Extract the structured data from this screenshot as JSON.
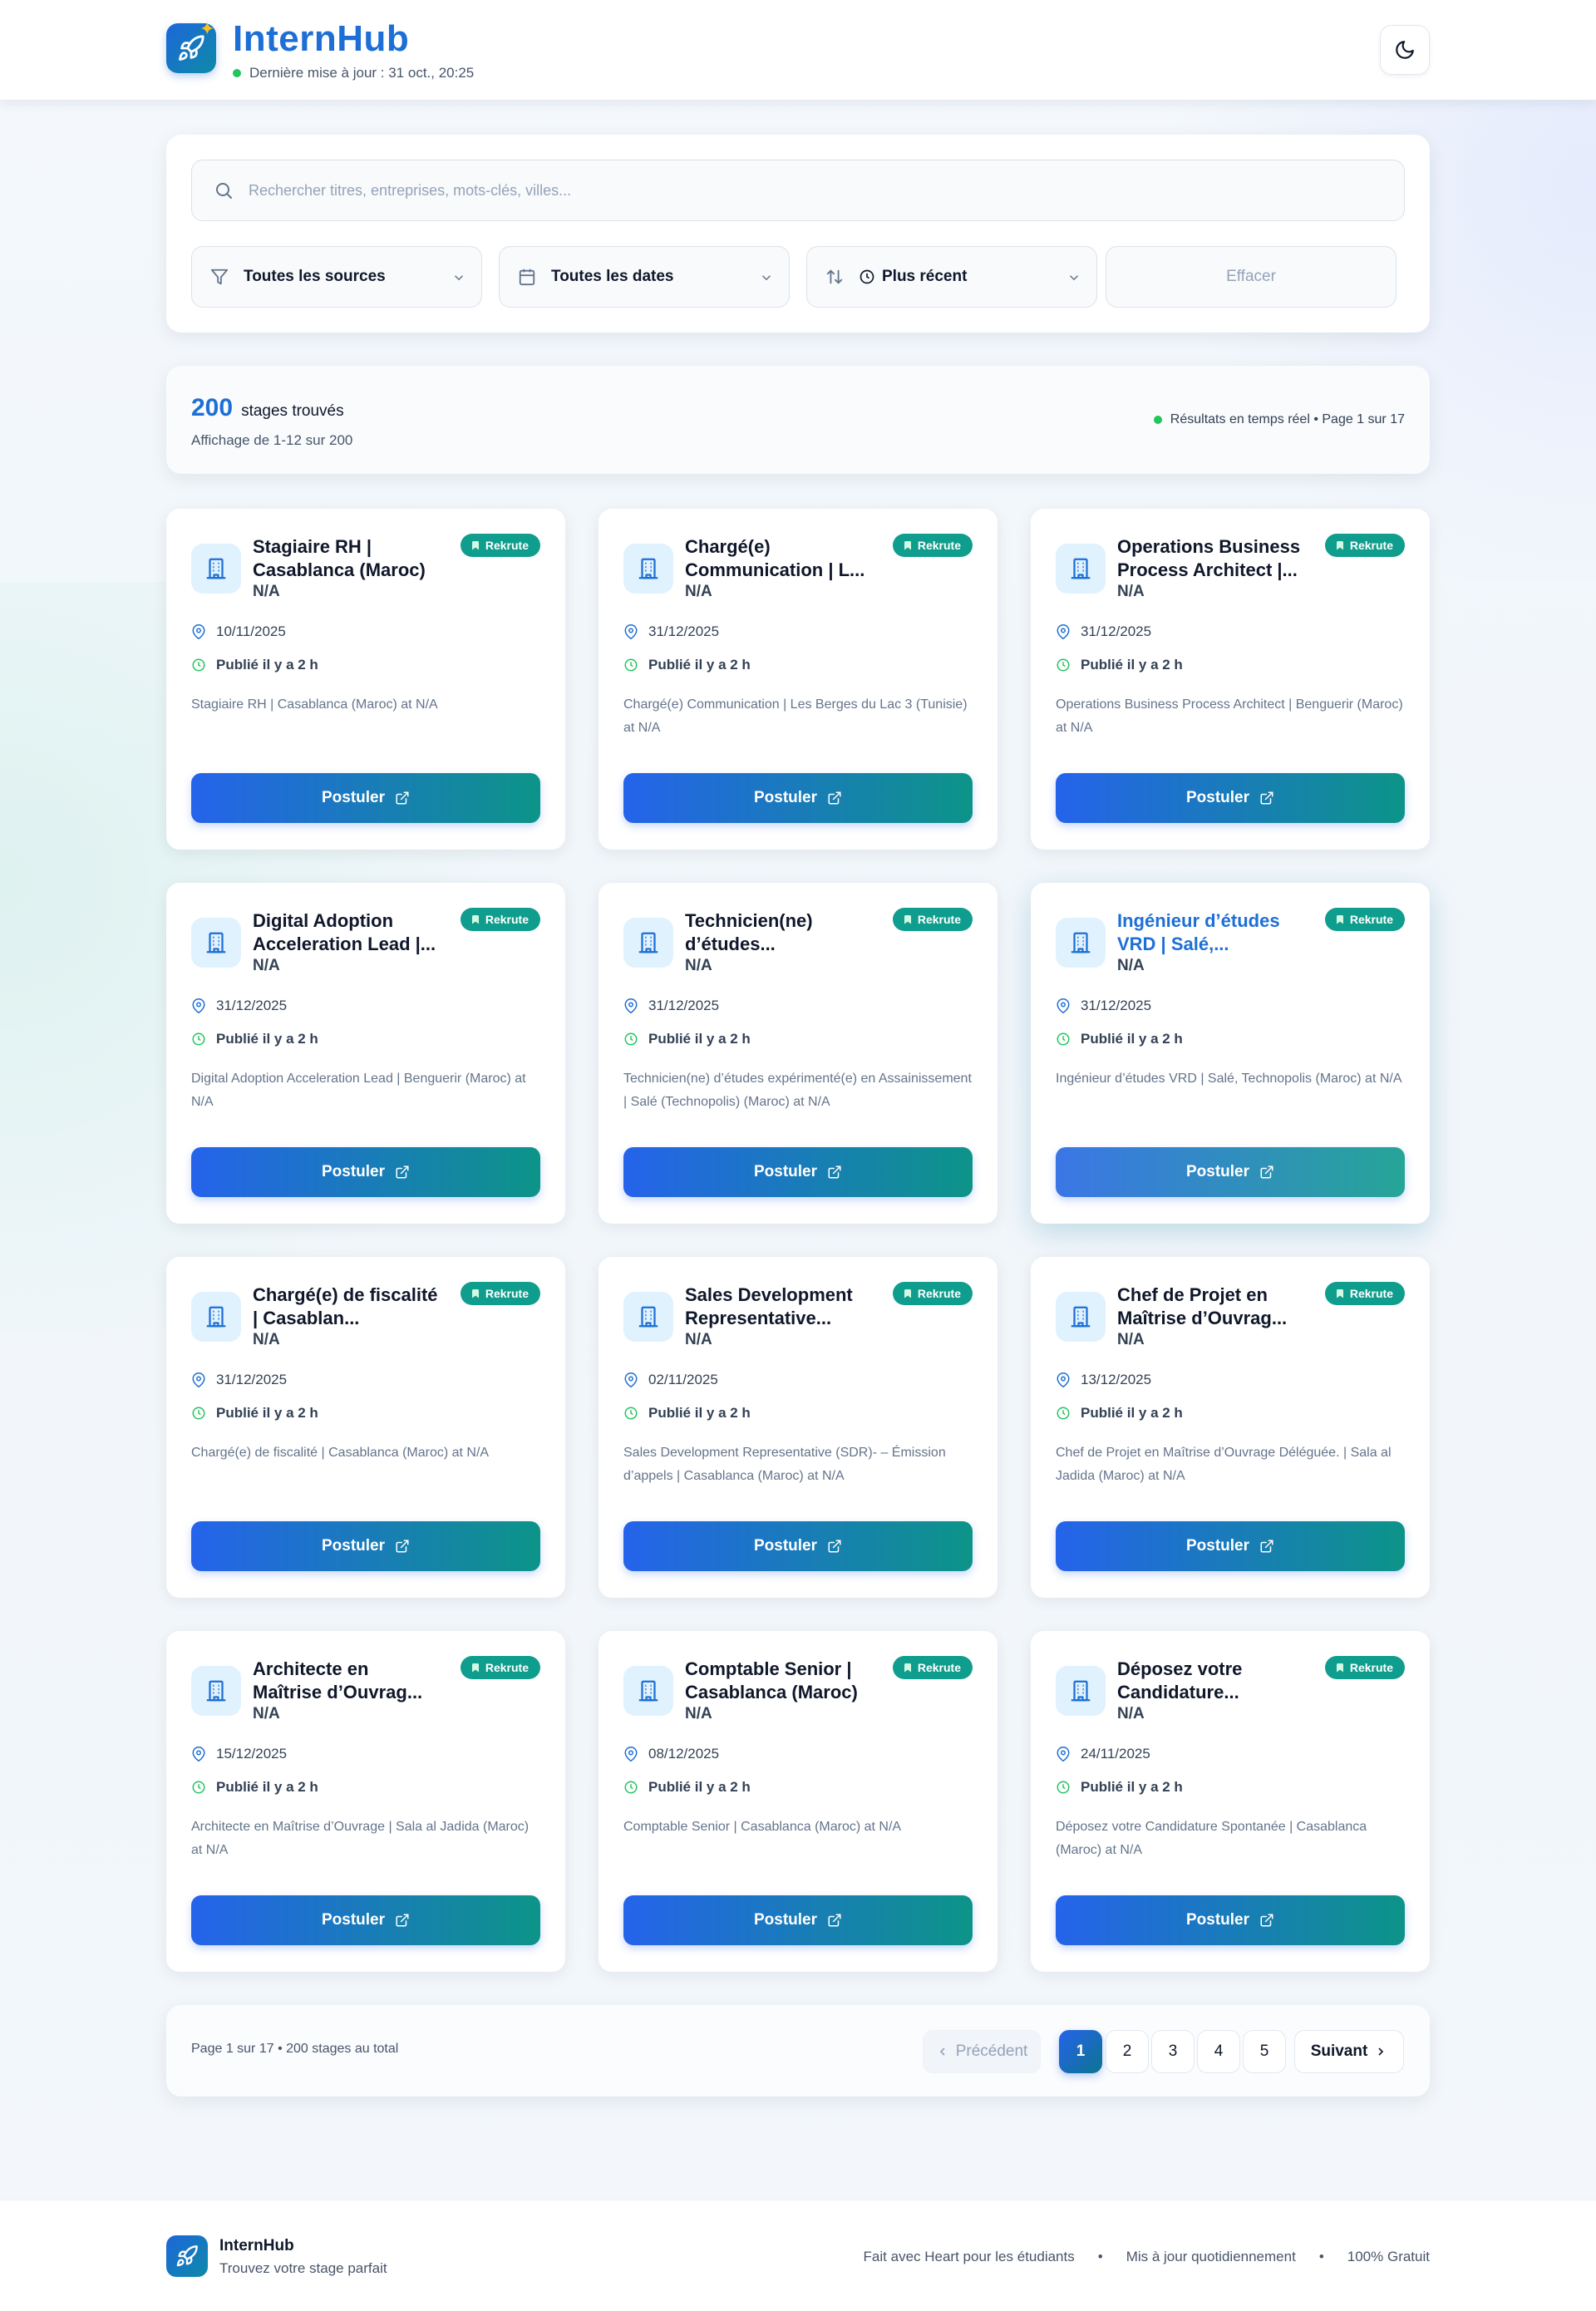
{
  "header": {
    "brand": "InternHub",
    "last_update": "Dernière mise à jour : 31 oct., 20:25",
    "theme_icon": "moon-icon"
  },
  "search": {
    "placeholder": "Rechercher titres, entreprises, mots-clés, villes...",
    "value": ""
  },
  "filters": {
    "source": "Toutes les sources",
    "date": "Toutes les dates",
    "sort": "Plus récent",
    "clear": "Effacer"
  },
  "results": {
    "count": "200",
    "count_label": "stages trouvés",
    "showing": "Affichage de 1-12 sur 200",
    "realtime": "Résultats en temps réel • Page 1 sur 17"
  },
  "card_common": {
    "badge": "Rekrute",
    "posted": "Publié il y a 2 h",
    "apply": "Postuler"
  },
  "jobs": [
    {
      "title": "Stagiaire RH | Casablanca (Maroc)",
      "company": "N/A",
      "date": "10/11/2025",
      "desc": "Stagiaire RH | Casablanca (Maroc) at N/A"
    },
    {
      "title": "Chargé(e) Communication | L...",
      "company": "N/A",
      "date": "31/12/2025",
      "desc": "Chargé(e) Communication | Les Berges du Lac 3 (Tunisie) at N/A"
    },
    {
      "title": "Operations Business Process Architect |...",
      "company": "N/A",
      "date": "31/12/2025",
      "desc": "Operations Business Process Architect | Benguerir (Maroc) at N/A"
    },
    {
      "title": "Digital Adoption Acceleration Lead |...",
      "company": "N/A",
      "date": "31/12/2025",
      "desc": "Digital Adoption Acceleration Lead | Benguerir (Maroc) at N/A"
    },
    {
      "title": "Technicien(ne) d’études...",
      "company": "N/A",
      "date": "31/12/2025",
      "desc": "Technicien(ne) d’études expérimenté(e) en Assainissement | Salé (Technopolis) (Maroc) at N/A"
    },
    {
      "title": "Ingénieur d’études VRD | Salé,...",
      "company": "N/A",
      "date": "31/12/2025",
      "desc": "Ingénieur d’études VRD | Salé, Technopolis (Maroc) at N/A"
    },
    {
      "title": "Chargé(e) de fiscalité | Casablan...",
      "company": "N/A",
      "date": "31/12/2025",
      "desc": "Chargé(e) de fiscalité | Casablanca (Maroc) at N/A"
    },
    {
      "title": "Sales Development Representative...",
      "company": "N/A",
      "date": "02/11/2025",
      "desc": "Sales Development Representative (SDR)- – Émission d’appels | Casablanca (Maroc) at N/A"
    },
    {
      "title": "Chef de Projet en Maîtrise d’Ouvrag...",
      "company": "N/A",
      "date": "13/12/2025",
      "desc": "Chef de Projet en Maîtrise d’Ouvrage Déléguée. | Sala al Jadida (Maroc) at N/A"
    },
    {
      "title": "Architecte en Maîtrise d’Ouvrag...",
      "company": "N/A",
      "date": "15/12/2025",
      "desc": "Architecte en Maîtrise d’Ouvrage | Sala al Jadida (Maroc) at N/A"
    },
    {
      "title": "Comptable Senior | Casablanca (Maroc)",
      "company": "N/A",
      "date": "08/12/2025",
      "desc": "Comptable Senior | Casablanca (Maroc) at N/A"
    },
    {
      "title": "Déposez votre Candidature...",
      "company": "N/A",
      "date": "24/11/2025",
      "desc": "Déposez votre Candidature Spontanée | Casablanca (Maroc) at N/A"
    }
  ],
  "pagination": {
    "info": "Page 1 sur 17 • 200 stages au total",
    "prev": "Précédent",
    "pages": [
      "1",
      "2",
      "3",
      "4",
      "5"
    ],
    "next": "Suivant"
  },
  "footer": {
    "brand": "InternHub",
    "tagline": "Trouvez votre stage parfait",
    "link1": "Fait avec Heart pour les étudiants",
    "link2": "Mis à jour quotidiennement",
    "link3": "100% Gratuit",
    "sep": "•"
  },
  "colors": {
    "brand_blue": "#1d6fd6",
    "badge_teal": "#0f9d8e",
    "button_gradient_start": "#2563eb",
    "button_gradient_end": "#0d9488",
    "status_green": "#22c55e"
  }
}
